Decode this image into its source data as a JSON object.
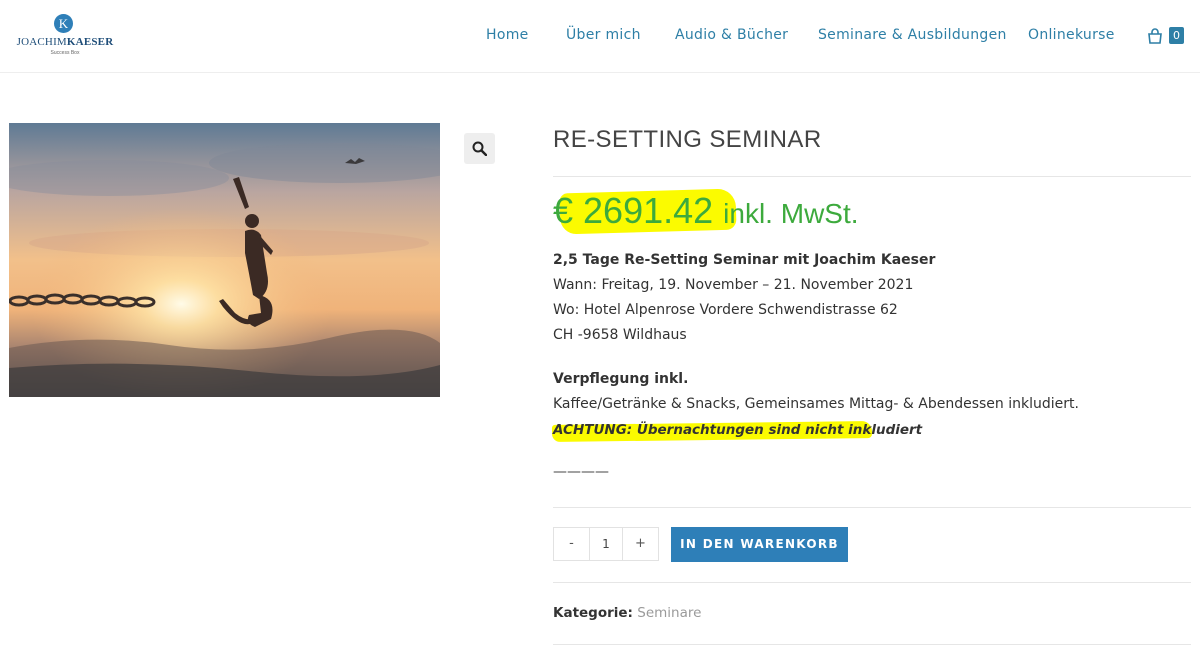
{
  "brand": {
    "logo_letter": "K",
    "logo_name_first": "JOACHIM",
    "logo_name_last": "KAESER",
    "logo_tagline": "Success Box"
  },
  "nav": {
    "items": [
      "Home",
      "Über mich",
      "Audio & Bücher",
      "Seminare & Ausbildungen",
      "Onlinekurse"
    ],
    "cart_count": "0"
  },
  "product": {
    "title": "RE-SETTING SEMINAR",
    "price": "€ 2691.42",
    "price_suffix": "inkl. MwSt.",
    "desc_heading": "2,5 Tage Re-Setting Seminar mit Joachim Kaeser",
    "when": "Wann: Freitag, 19. November – 21. November 2021",
    "where": "Wo: Hotel Alpenrose Vordere Schwendistrasse 62",
    "location": "CH -9658 Wildhaus",
    "catering_heading": "Verpflegung inkl.",
    "catering_text": "Kaffee/Getränke & Snacks, Gemeinsames Mittag- & Abendessen inkludiert.",
    "warning": "ACHTUNG: Übernachtungen sind nicht inkludiert",
    "divider_text": "————",
    "quantity": "1",
    "minus_label": "-",
    "plus_label": "+",
    "add_to_cart_label": "IN DEN WARENKORB",
    "category_label": "Kategorie:",
    "category_value": "Seminare"
  },
  "colors": {
    "accent": "#2e7fb8",
    "nav_text": "#2e7fa6",
    "price": "#3daa3d",
    "highlight": "#fbfb00"
  },
  "icons": {
    "cart": "shopping-bag-icon",
    "zoom": "magnifier-icon"
  }
}
